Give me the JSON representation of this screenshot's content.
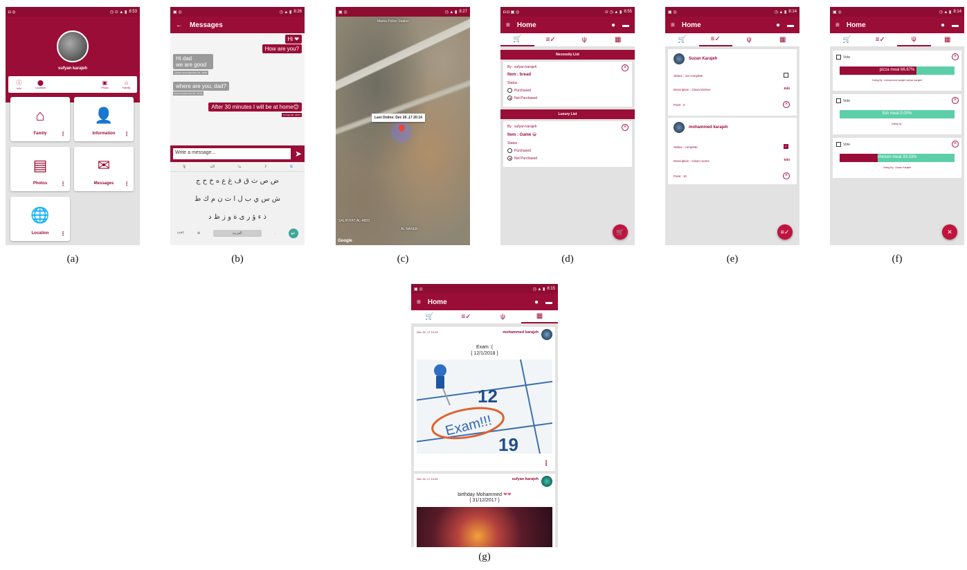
{
  "colors": {
    "primary": "#9a0d37",
    "accent": "#c0143f",
    "vote_bar": "#5ccfa8"
  },
  "captions": [
    "(a)",
    "(b)",
    "(c)",
    "(d)",
    "(e)",
    "(f)",
    "(g)"
  ],
  "a": {
    "time": "8:53",
    "name": "sufyan karajeh",
    "quick": [
      {
        "icon": "info-icon",
        "label": "Info"
      },
      {
        "icon": "location-pin-icon",
        "label": "Location"
      },
      {
        "icon": "photo-icon",
        "label": "Photo"
      },
      {
        "icon": "home-icon",
        "label": "Family"
      }
    ],
    "cards": [
      {
        "icon": "house-icon",
        "label": "Family"
      },
      {
        "icon": "person-info-icon",
        "label": "Information"
      },
      {
        "icon": "photos-icon",
        "label": "Photos"
      },
      {
        "icon": "envelope-icon",
        "label": "Messages"
      },
      {
        "icon": "globe-pin-icon",
        "label": "Location"
      }
    ]
  },
  "b": {
    "time": "8:26",
    "title": "Messages",
    "messages": [
      {
        "from": "me",
        "text": "Hi ❤"
      },
      {
        "from": "me",
        "text": "How are you?"
      },
      {
        "from": "them",
        "text": "Hi dad"
      },
      {
        "from": "them",
        "text": "we are good"
      },
      {
        "from": "them",
        "meta": "mohammed karajeh  Dec 26 , 19:50"
      },
      {
        "from": "them",
        "text": "where are you, dad?"
      },
      {
        "from": "them",
        "meta": "Suzan Karajeh  Dec 26 , 20:14"
      },
      {
        "from": "me",
        "text": "After 30 minutes I will be at home😊"
      },
      {
        "from": "me",
        "meta": "You  Dec 26 , 20:17"
      }
    ],
    "input_placeholder": "Write a message...",
    "kb_suggestions": [
      "الله",
      "ما",
      "لا"
    ],
    "kb_rows": [
      "ض ص ث ق ف غ ع ه خ ح ج",
      "ش س ي ب ل ا ت ن م ك ط",
      "ذ ء ؤ ر ى ة و ز ظ د"
    ],
    "kb_bottom": {
      "left": "؟١٢٣",
      "space": "العربية"
    }
  },
  "c": {
    "time": "8:27",
    "tooltip": "Last Online: Dec 26 ,17  20:14",
    "labels": {
      "station": "Marka Police Station",
      "south": "SALIHIYAT AL-ABID",
      "east": "AL NASER"
    },
    "google": "Google"
  },
  "d": {
    "time": "8:55",
    "title": "Home",
    "necessity_header": "Necessity List",
    "luxury_header": "Luxury List",
    "items": [
      {
        "by": "By : sufyan karajeh",
        "item": "Item : bread",
        "status_label": "Status :",
        "opt1": "Purchased",
        "opt2": "Not Purchased"
      },
      {
        "by": "By : sufyan karajeh",
        "item": "Item : Game 😀",
        "status_label": "Status :",
        "opt1": "Purchased",
        "opt2": "Not Purchased"
      }
    ]
  },
  "e": {
    "time": "8:14",
    "title": "Home",
    "tasks": [
      {
        "name": "Suzan Karajeh",
        "status": "Status : not complete",
        "checked": false,
        "desc": "Description : Clean kitchen",
        "edit": "Edit",
        "point": "Point : 0"
      },
      {
        "name": "mohammed karajeh",
        "status": "Status : complete",
        "checked": true,
        "desc": "Description : Clean rooms",
        "edit": "Edit",
        "point": "Point : 10"
      }
    ]
  },
  "f": {
    "time": "8:14",
    "title": "Home",
    "polls": [
      {
        "vote": "Vote",
        "label": "pizza meal 66.67%",
        "fraction": 0.6667,
        "by": "Voting By : mohammed karajeh  sufyan karajeh"
      },
      {
        "vote": "Vote",
        "label": "fish meal 0.00%",
        "fraction": 0.0,
        "by": "Voting By :"
      },
      {
        "vote": "Vote",
        "label": "chicken meal 33.33%",
        "fraction": 0.3333,
        "by": "Voting By : Suzan Karajeh"
      }
    ]
  },
  "g": {
    "time": "8:15",
    "title": "Home",
    "posts": [
      {
        "date": "Dec 26 ,17  19:29",
        "author": "mohammed karajeh",
        "line1": "Exam :(",
        "line2": "{   12/1/2018 }",
        "image_text": "Exam!!!"
      },
      {
        "date": "Dec 26 ,17  19:25",
        "author": "sufyan karajeh",
        "line1": "birthday  Mohammed",
        "line2": "{   31/12/2017 }"
      }
    ]
  }
}
